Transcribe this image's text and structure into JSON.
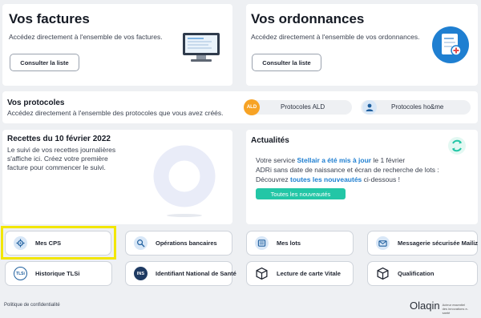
{
  "invoices": {
    "title": "Vos factures",
    "description": "Accédez directement à l'ensemble de vos factures.",
    "button": "Consulter la liste"
  },
  "prescriptions": {
    "title": "Vos ordonnances",
    "description": "Accédez directement à l'ensemble de vos ordonnances.",
    "button": "Consulter la liste"
  },
  "protocols": {
    "title": "Vos protocoles",
    "description": "Accédez directement à l'ensemble des protocoles que vous avez créés.",
    "links": [
      {
        "label": "Protocoles ALD",
        "icon": "ald-icon"
      },
      {
        "label": "Protocoles ho&me",
        "icon": "home-protocol-icon"
      }
    ]
  },
  "receipts": {
    "title": "Recettes du 10 février 2022",
    "text": "Le suivi de vos recettes journalières s'affiche ici. Créez votre première facture pour commencer le suivi."
  },
  "news": {
    "title": "Actualités",
    "line1_pre": "Votre service ",
    "line1_link": "Stellair a été mis à jour",
    "line1_post": " le 1 février",
    "line2": "ADRi sans date de naissance et écran de recherche de lots :",
    "line3_pre": "Découvrez ",
    "line3_link": "toutes les nouveautés",
    "line3_post": " ci-dessous !",
    "button": "Toutes les nouveautés"
  },
  "tiles": [
    {
      "label": "Mes CPS",
      "icon": "gear-icon",
      "highlighted": true
    },
    {
      "label": "Opérations bancaires",
      "icon": "bank-search-icon"
    },
    {
      "label": "Mes lots",
      "icon": "batch-icon"
    },
    {
      "label": "Messagerie sécurisée Mailiz",
      "icon": "mail-icon"
    },
    {
      "label": "Historique TLSi",
      "icon": "tlsi-icon"
    },
    {
      "label": "Identifiant National de Santé",
      "icon": "ins-icon"
    },
    {
      "label": "Lecture de carte Vitale",
      "icon": "cube-icon"
    },
    {
      "label": "Qualification",
      "icon": "cube-icon"
    }
  ],
  "footer": {
    "privacy": "Politique de confidentialité",
    "brand": "Olaqin",
    "tagline": "Acteur essentiel des innovations e-santé"
  },
  "colors": {
    "accent_blue": "#1f7fd1",
    "news_button": "#23c6a6",
    "highlight": "#f2e600",
    "donut": "#e9ecf8"
  }
}
